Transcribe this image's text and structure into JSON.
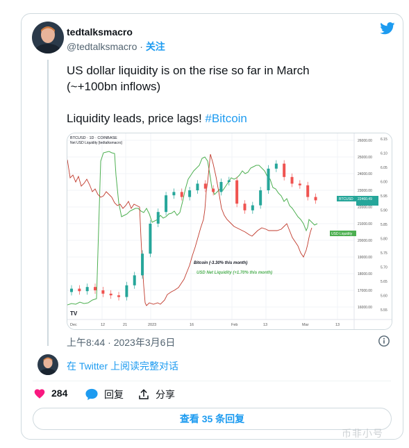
{
  "tweet": {
    "author_name": "tedtalksmacro",
    "author_handle": "@tedtalksmacro",
    "separator": " · ",
    "follow_label": "关注",
    "text_line1": "US dollar liquidity is on the rise so far in March",
    "text_line2": "(~+100bn inflows)",
    "text_line3": "Liquidity leads, price lags!",
    "hashtag": "#Bitcoin",
    "timestamp": "上午8:44 · 2023年3月6日",
    "reply_prompt": "在 Twitter 上阅读完整对话",
    "like_count": "284",
    "reply_label": "回复",
    "share_label": "分享",
    "view_replies": "查看 35 条回复"
  },
  "chart": {
    "header_line1": "BTCUSD · 1D · COINBASE",
    "header_line2": "Net USD Liquidity [tedtalksmacro]",
    "annotation_bitcoin": "Bitcoin (-3.30% this month)",
    "annotation_liquidity": "USD Net Liquidity (+1.70% this month)",
    "badge_btc": "BTCUSD",
    "badge_btc_price": "22460.49",
    "badge_usd": "USD Liquidity",
    "logo": "TV",
    "x_ticks": [
      "Dec",
      "12",
      "21",
      "2023",
      "16",
      "Feb",
      "13",
      "Mar",
      "13"
    ],
    "y_left_ticks": [
      "26000.00",
      "25000.00",
      "24000.00",
      "23000.00",
      "22000.00",
      "21000.00",
      "20000.00",
      "19000.00",
      "18000.00",
      "17000.00",
      "16000.00"
    ],
    "y_right_ticks": [
      "6.15",
      "6.10",
      "6.05",
      "6.00",
      "5.95",
      "5.90",
      "5.85",
      "5.80",
      "5.75",
      "5.70",
      "5.65",
      "5.60",
      "5.55"
    ],
    "colors": {
      "up": "#26a69a",
      "down": "#ef5350",
      "liquidity": "#4caf50",
      "price_line": "#c0392b"
    },
    "candles_btc_close_approx": [
      17100,
      16950,
      17200,
      17000,
      16800,
      16700,
      16600,
      17300,
      17900,
      19200,
      21000,
      21700,
      22700,
      22900,
      22600,
      23000,
      23400,
      23100,
      22900,
      23500,
      23600,
      22200,
      21800,
      22100,
      23000,
      24300,
      24600,
      23800,
      23400,
      23300,
      22600,
      22400
    ]
  },
  "watermark": "币非小号"
}
